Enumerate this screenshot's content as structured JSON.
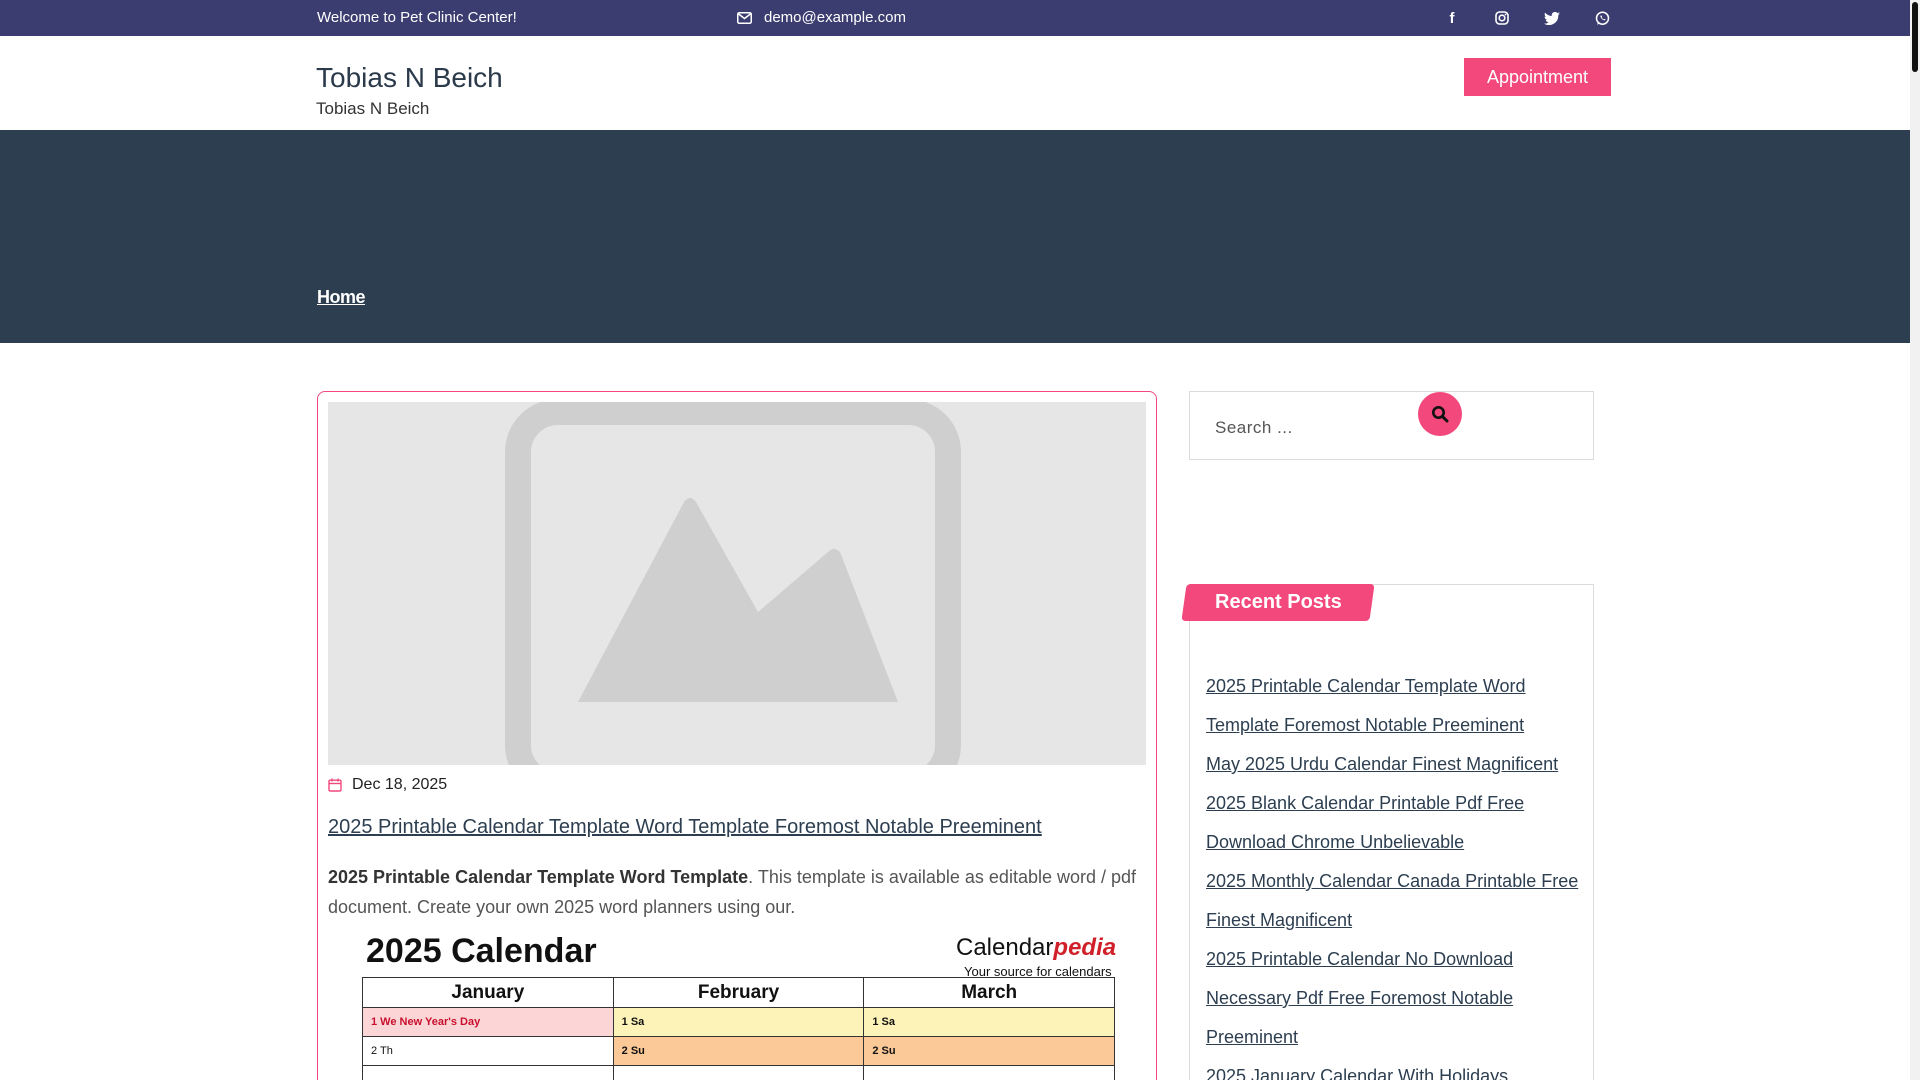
{
  "topbar": {
    "welcome": "Welcome to Pet Clinic Center!",
    "email": "demo@example.com",
    "socials": [
      "facebook-icon",
      "instagram-icon",
      "twitter-icon",
      "whatsapp-icon"
    ]
  },
  "header": {
    "site_title": "Tobias N Beich",
    "tagline": "Tobias N Beich",
    "appointment_label": "Appointment"
  },
  "hero": {
    "breadcrumb": "Home"
  },
  "post": {
    "date": "Dec 18, 2025",
    "title": "2025 Printable Calendar Template Word Template Foremost Notable Preeminent",
    "excerpt_bold": "2025 Printable Calendar Template Word Template",
    "excerpt_rest": ". This template is available as editable word / pdf document. Create your own 2025 word planners using our.",
    "calendar_image": {
      "title": "2025 Calendar",
      "brand_main": "Calendar",
      "brand_accent": "pedia",
      "brand_sub": "Your source for calendars",
      "months": [
        "January",
        "February",
        "March"
      ],
      "rows": [
        [
          "1  We   New Year's Day",
          "1  Sa",
          "1  Sa"
        ],
        [
          "2  Th",
          "2  Su",
          "2  Su"
        ],
        [
          "",
          "",
          ""
        ]
      ]
    }
  },
  "sidebar": {
    "search_placeholder": "Search ...",
    "recent_title": "Recent Posts",
    "recent_posts": [
      "2025 Printable Calendar Template Word Template Foremost Notable Preeminent",
      "May 2025 Urdu Calendar Finest Magnificent",
      "2025 Blank Calendar Printable Pdf Free Download Chrome Unbelievable",
      "2025 Monthly Calendar Canada Printable Free Finest Magnificent",
      "2025 Printable Calendar No Download Necessary Pdf Free Foremost Notable Preeminent",
      "2025 January Calendar With Holidays"
    ]
  },
  "colors": {
    "topbar_bg": "#3b3d70",
    "hero_bg": "#2c3e50",
    "accent": "#f2487c"
  }
}
